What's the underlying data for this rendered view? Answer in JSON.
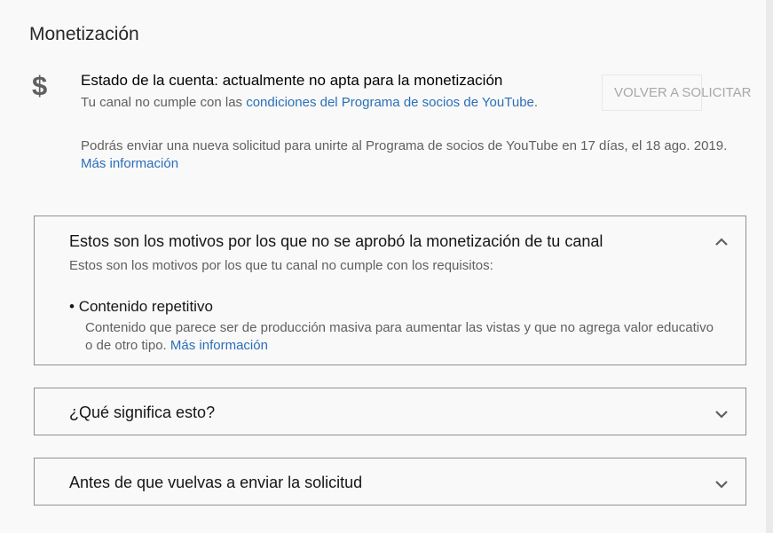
{
  "monetization": {
    "title": "Monetización",
    "icon": "dollar-icon",
    "icon_glyph": "$",
    "status": "Estado de la cuenta: actualmente no apta para la monetización",
    "sub_prefix": "Tu canal no cumple con las ",
    "sub_link": "condiciones del Programa de socios de YouTube",
    "sub_suffix": ".",
    "reapply_button": "VOLVER A SOLICITAR",
    "note_text": "Podrás enviar una nueva solicitud para unirte al Programa de socios de YouTube en 17 días, el 18 ago. 2019.",
    "note_link": "Más información"
  },
  "panels": [
    {
      "title": "Estos son los motivos por los que no se aprobó la monetización de tu canal",
      "expanded": true,
      "subtitle": "Estos son los motivos por los que tu canal no cumple con los requisitos:",
      "reason": "Contenido repetitivo",
      "reason_desc": "Contenido que parece ser de producción masiva para aumentar las vistas y que no agrega valor educativo o de otro tipo.",
      "reason_link": "Más información"
    },
    {
      "title": "¿Qué significa esto?",
      "expanded": false
    },
    {
      "title": "Antes de que vuelvas a enviar la solicitud",
      "expanded": false
    }
  ],
  "colors": {
    "link": "#2a6fb8",
    "text": "#030303",
    "secondary": "#606060",
    "disabled": "#a8a8a8"
  }
}
